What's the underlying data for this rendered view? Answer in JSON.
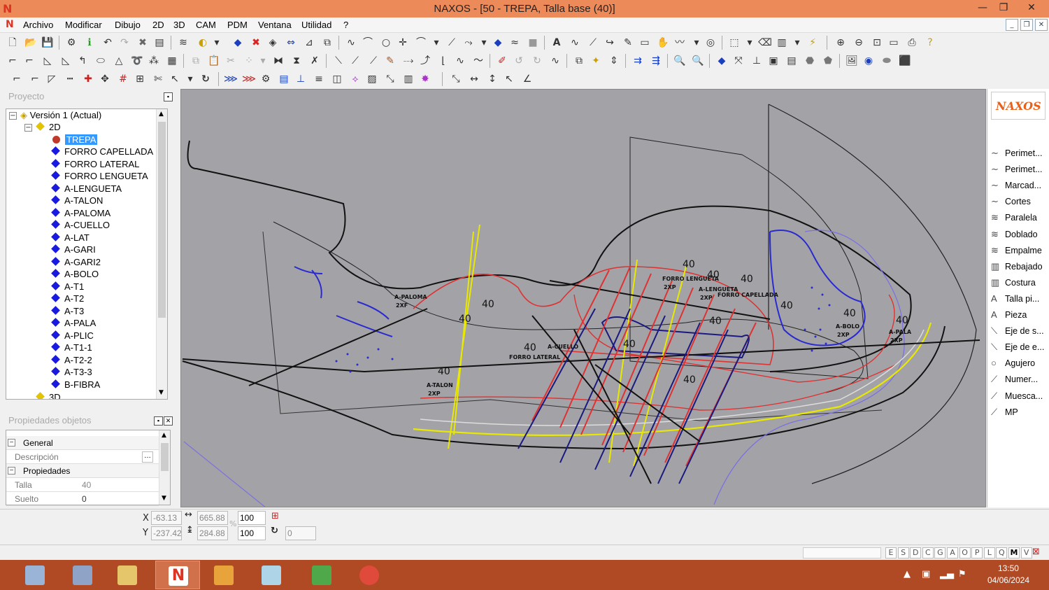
{
  "window": {
    "title": "NAXOS - [50 - TREPA, Talla base (40)]",
    "controls": [
      "—",
      "❐",
      "✕"
    ]
  },
  "menu": {
    "items": [
      "Archivo",
      "Modificar",
      "Dibujo",
      "2D",
      "3D",
      "CAM",
      "PDM",
      "Ventana",
      "Utilidad",
      "?"
    ]
  },
  "project_panel": {
    "title": "Proyecto",
    "version_label": "Versión 1 (Actual)",
    "folder_2d": "2D",
    "folder_3d": "3D",
    "selected_piece": "TREPA",
    "pieces": [
      "FORRO CAPELLADA",
      "FORRO LATERAL",
      "FORRO LENGUETA",
      "A-LENGUETA",
      "A-TALON",
      "A-PALOMA",
      "A-CUELLO",
      "A-LAT",
      "A-GARI",
      "A-GARI2",
      "A-BOLO",
      "A-T1",
      "A-T2",
      "A-T3",
      "A-PALA",
      "A-PLIC",
      "A-T1-1",
      "A-T2-2",
      "A-T3-3",
      "B-FIBRA"
    ]
  },
  "properties_panel": {
    "title": "Propiedades objetos",
    "section_general": "General",
    "descripcion_label": "Descripción",
    "descripcion_value": "",
    "section_propiedades": "Propiedades",
    "talla_label": "Talla",
    "talla_value": "40",
    "suelto_label": "Suelto",
    "suelto_value": "0"
  },
  "right_panel": {
    "logo_text": "NAXOS",
    "items": [
      {
        "label": "Perimet...",
        "icon": "curve-icon"
      },
      {
        "label": "Perimet...",
        "icon": "curve-icon"
      },
      {
        "label": "Marcad...",
        "icon": "curve-icon"
      },
      {
        "label": "Cortes",
        "icon": "curve-icon"
      },
      {
        "label": "Paralela",
        "icon": "parallel-icon"
      },
      {
        "label": "Doblado",
        "icon": "parallel-icon"
      },
      {
        "label": "Empalme",
        "icon": "parallel-icon"
      },
      {
        "label": "Rebajado",
        "icon": "hatch-icon"
      },
      {
        "label": "Costura",
        "icon": "hatch-icon"
      },
      {
        "label": "Talla pi...",
        "icon": "text-a-icon"
      },
      {
        "label": "Pieza",
        "icon": "text-a-icon"
      },
      {
        "label": "Eje de s...",
        "icon": "axis-icon"
      },
      {
        "label": "Eje de e...",
        "icon": "axis-icon"
      },
      {
        "label": "Agujero",
        "icon": "circle-icon"
      },
      {
        "label": "Numer...",
        "icon": "pen-icon"
      },
      {
        "label": "Muesca...",
        "icon": "pen-icon"
      },
      {
        "label": "MP",
        "icon": "pen-icon"
      }
    ]
  },
  "coords": {
    "x_label": "X",
    "y_label": "Y",
    "x": "-63.13",
    "y": "-237.42",
    "width": "665.88",
    "height": "284.88",
    "scale_x": "100",
    "scale_y": "100",
    "percent": "%",
    "rotation": "0"
  },
  "status_modes": [
    "E",
    "S",
    "D",
    "C",
    "G",
    "A",
    "O",
    "P",
    "L",
    "Q",
    "M",
    "V"
  ],
  "canvas_labels": [
    {
      "text": "A-PALOMA",
      "sub": "2XF"
    },
    {
      "text": "FORRO LENGUETA",
      "sub": "2XP"
    },
    {
      "text": "A-LENGUETA",
      "sub": "2XP"
    },
    {
      "text": "FORRO CAPELLADA",
      "sub": ""
    },
    {
      "text": "A-CUELLO",
      "sub": ""
    },
    {
      "text": "FORRO LATERAL",
      "sub": ""
    },
    {
      "text": "A-TALON",
      "sub": "2XP"
    },
    {
      "text": "A-BOLO",
      "sub": "2XP"
    },
    {
      "text": "A-PALA",
      "sub": "2XP"
    }
  ],
  "size_markers": [
    "40",
    "40",
    "40",
    "40",
    "40",
    "40",
    "40",
    "40",
    "40",
    "40",
    "40",
    "40",
    "40"
  ],
  "clock": {
    "time": "13:50",
    "date": "04/06/2024"
  },
  "colors": {
    "titlebar": "#ed8a5a",
    "canvas": "#a3a3a7",
    "taskbar": "#b04a24",
    "selection": "#3399ff"
  }
}
